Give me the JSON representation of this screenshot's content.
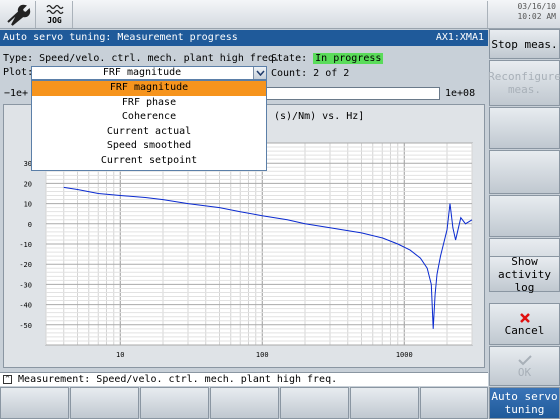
{
  "topbar": {
    "tool_icon": "wrench-icon",
    "jog_label": "JOG",
    "date": "03/16/10",
    "time": "10:02 AM"
  },
  "title": {
    "text": "Auto servo tuning: Measurement progress",
    "axis": "AX1:XMA1"
  },
  "info": {
    "type_label": "Type:",
    "type_value": "Speed/velo. ctrl. mech. plant high freq.",
    "plot_label": "Plot:",
    "plot_value": "FRF magnitude",
    "state_label": "State:",
    "state_value": "In progress",
    "count_label": "Count:",
    "count_value": "2 of 2",
    "range_min": "−1e+",
    "range_max": "1e+08"
  },
  "dropdown": {
    "options": [
      "FRF magnitude",
      "FRF phase",
      "Coherence",
      "Current actual",
      "Speed smoothed",
      "Current setpoint"
    ],
    "selected": "FRF magnitude"
  },
  "chart": {
    "title_fragment": "(s)/Nm) vs. Hz]"
  },
  "chart_data": {
    "type": "line",
    "title": "(s)/Nm) vs. Hz]",
    "xscale": "log",
    "xlim": [
      3,
      3000
    ],
    "xticks": [
      "10",
      "100",
      "1000"
    ],
    "yticks": [
      "30",
      "20",
      "10",
      "0",
      "-10",
      "-20",
      "-30",
      "-40",
      "-50"
    ],
    "ylim": [
      -60,
      40
    ],
    "series": [
      {
        "color": "#0a2ad0",
        "x": [
          4,
          5,
          7,
          10,
          15,
          20,
          30,
          50,
          70,
          100,
          150,
          200,
          300,
          500,
          700,
          900,
          1100,
          1300,
          1450,
          1550,
          1600,
          1650,
          1700,
          1800,
          2000,
          2100,
          2200,
          2300,
          2500,
          2700,
          3000
        ],
        "y": [
          18,
          17,
          15,
          14,
          13,
          12,
          10,
          8,
          6,
          4,
          2,
          0,
          -2,
          -4.5,
          -7,
          -10,
          -13,
          -17,
          -22,
          -30,
          -52,
          -35,
          -25,
          -16,
          -3,
          10,
          -2,
          -8,
          3,
          0,
          2
        ]
      }
    ]
  },
  "status": {
    "text": "Measurement: Speed/velo. ctrl. mech. plant high freq."
  },
  "softkeys": {
    "stop": "Stop meas.",
    "reconfigure": "Reconfigure meas.",
    "show_log": "Show activity log",
    "cancel": "Cancel",
    "ok": "OK",
    "auto_tuning": "Auto servo tuning"
  }
}
